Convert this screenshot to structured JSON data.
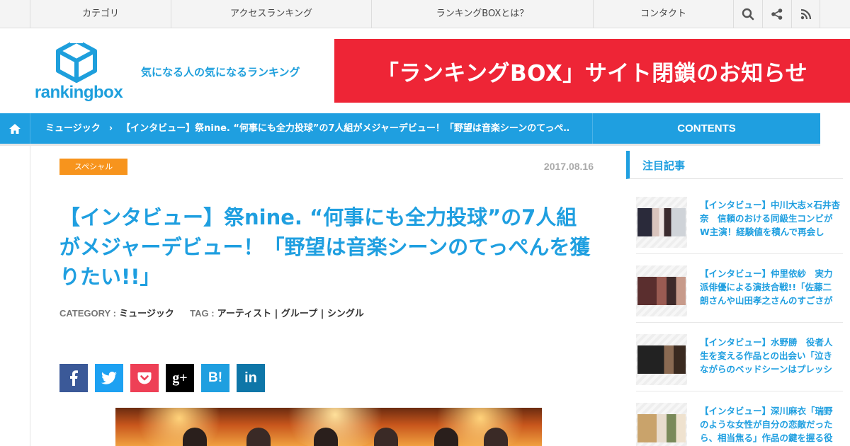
{
  "topnav": {
    "items": [
      "カテゴリ",
      "アクセスランキング",
      "ランキングBOXとは？",
      "コンタクト"
    ],
    "icons": [
      "search-icon",
      "share-icon",
      "rss-icon"
    ]
  },
  "header": {
    "logo_text": "rankingbox",
    "tagline": "気になる人の気になるランキング",
    "banner": "「ランキングBOX」サイト閉鎖のお知らせ"
  },
  "breadcrumb": {
    "category": "ミュージック",
    "separator": "›",
    "current": "【インタビュー】祭nine. “何事にも全力投球”の7人組がメジャーデビュー！「野望は音楽シーンのてっぺ…",
    "contents_tab": "CONTENTS"
  },
  "article": {
    "badge": "スペシャル",
    "date": "2017.08.16",
    "title": "【インタビュー】祭nine. “何事にも全力投球”の7人組がメジャーデビュー！「野望は音楽シーンのてっぺんを獲りたい!!」",
    "category_label": "CATEGORY :",
    "category": "ミュージック",
    "tag_label": "TAG :",
    "tags": "アーティスト | グループ | シングル"
  },
  "share": [
    {
      "name": "facebook",
      "label": "f",
      "color": "#3b5998"
    },
    {
      "name": "twitter",
      "label": "t",
      "color": "#1da1f2"
    },
    {
      "name": "pocket",
      "label": "p",
      "color": "#ee4056"
    },
    {
      "name": "googleplus",
      "label": "g+",
      "color": "#000000"
    },
    {
      "name": "hatena",
      "label": "B!",
      "color": "#1f9fe0"
    },
    {
      "name": "linkedin",
      "label": "in",
      "color": "#0e76a8"
    }
  ],
  "sidebar": {
    "heading": "注目記事",
    "items": [
      {
        "text": "【インタビュー】中川大志×石井杏奈　信頼のおける同級生コンビがW主演！経験値を積んで再会し"
      },
      {
        "text": "【インタビュー】仲里依紗　実力派俳優による演技合戦!!「佐藤二朗さんや山田孝之さんのすごさが"
      },
      {
        "text": "【インタビュー】水野勝　役者人生を変える作品との出会い「泣きながらのベッドシーンはプレッシ"
      },
      {
        "text": "【インタビュー】深川麻衣「瑞野のような女性が自分の恋敵だったら、相当焦る」作品の鍵を握る役"
      }
    ]
  },
  "colors": {
    "accent": "#1f9fe0",
    "banner": "#ee2536",
    "badge": "#f7941d"
  }
}
